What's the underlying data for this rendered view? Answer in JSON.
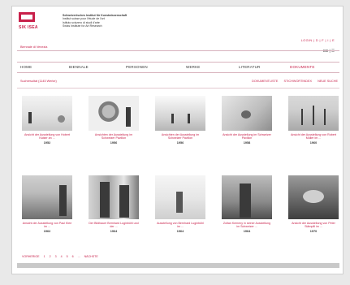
{
  "header": {
    "logo_text": "SIK ISEA",
    "institute_lines": [
      "Schweizerisches Institut für Kunstwissenschaft",
      "Institut suisse pour l'étude de l'art",
      "Istituto svizzero di studi d'arte",
      "Swiss Institute for Art Research"
    ]
  },
  "topbar": {
    "breadcrumb": "Biennale di Venezia",
    "login_links": "LOGIN | D | F | I | E",
    "langs": "ED | ☰"
  },
  "nav": {
    "items": [
      "HOME",
      "BIENNALE",
      "PERSONEN",
      "WERKE",
      "LITERATUR",
      "DOKUMENTE"
    ],
    "active": "DOKUMENTE"
  },
  "subbar": {
    "left": "Suchresultat (1145 Werke)",
    "right": [
      "DOKUMENTLISTE",
      "STICHWORTINDEX",
      "NEUE SUCHE"
    ]
  },
  "cards": [
    {
      "caption": "Ansicht der Ausstellung von Hobert Kaiser an ...",
      "year": "1952"
    },
    {
      "caption": "Ansichten der Ausstellung im Schweizer Pavillon",
      "year": "1956"
    },
    {
      "caption": "Ansichten der Ausstellung im Schweizer Pavillon",
      "year": "1956"
    },
    {
      "caption": "Ansicht der Ausstellung im Schweizer Pavillon",
      "year": "1958"
    },
    {
      "caption": "Ansicht der Ausstellung von Robert Müller im ...",
      "year": "1960"
    },
    {
      "caption": "Ansicht der Ausstellung von Paul Klee im ...",
      "year": "1962"
    },
    {
      "caption": "Der Bildhauer Bernhard Luginbühl und der ...",
      "year": "1964"
    },
    {
      "caption": "Ausstellung von Bernhard Luginbühl im ...",
      "year": "1964"
    },
    {
      "caption": "Zoltan Kemeny in seiner Ausstellung im Schweizer ...",
      "year": "1964"
    },
    {
      "caption": "Ansicht der Ausstellung von Peter Stämpfli im ...",
      "year": "1970"
    }
  ],
  "pager": {
    "items": [
      "VORHERIGE",
      "1",
      "2",
      "3",
      "4",
      "5",
      "6",
      "...",
      "NÄCHSTE"
    ]
  },
  "colors": {
    "accent": "#c8204a",
    "text": "#333333",
    "background": "#ffffff"
  }
}
